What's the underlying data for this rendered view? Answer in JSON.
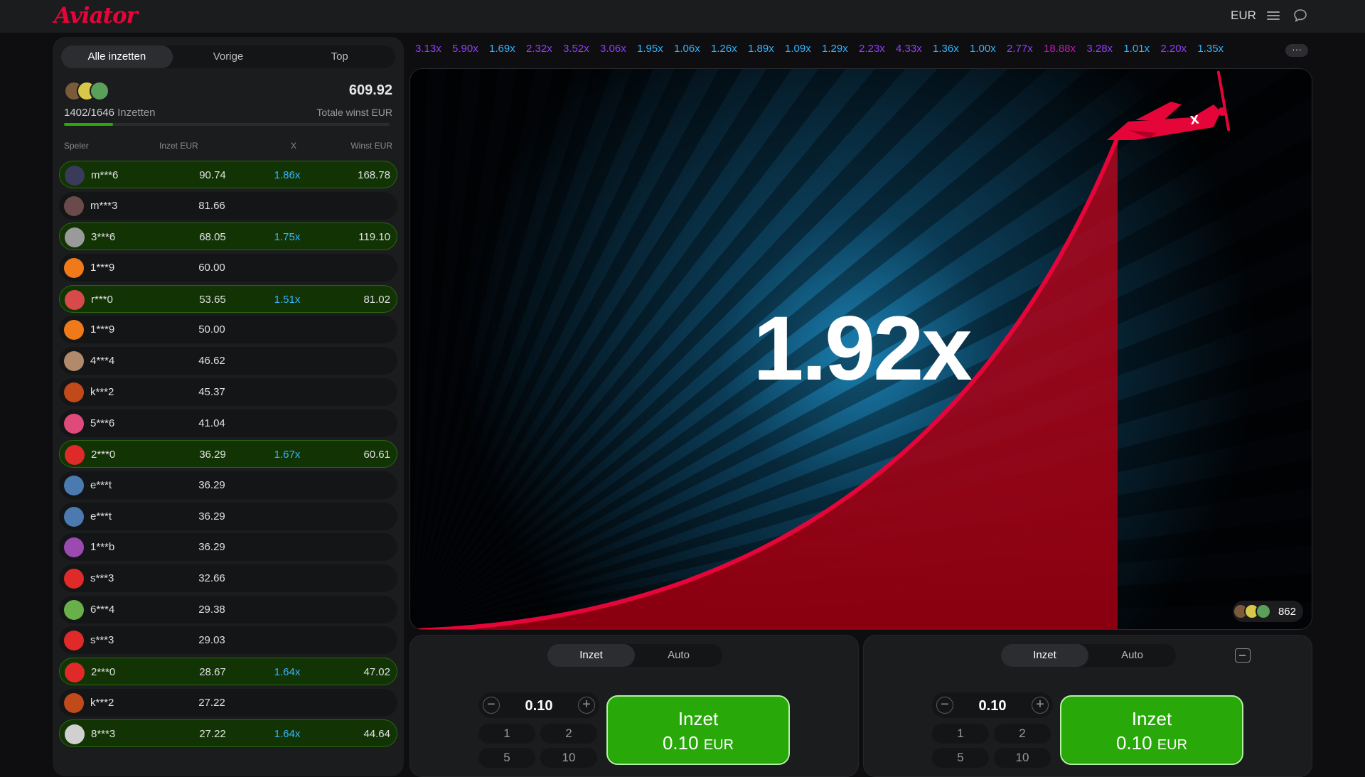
{
  "app": {
    "logo": "Aviator",
    "currency": "EUR"
  },
  "left": {
    "tabs": [
      {
        "label": "Alle inzetten",
        "active": true
      },
      {
        "label": "Vorige",
        "active": false
      },
      {
        "label": "Top",
        "active": false
      }
    ],
    "stats": {
      "total_win": "609.92",
      "bet_count": "1402/1646",
      "bet_count_label": "Inzetten",
      "total_win_label": "Totale winst EUR",
      "progress_fraction": 0.15
    },
    "columns": {
      "player": "Speler",
      "bet": "Inzet EUR",
      "mult": "X",
      "win": "Winst EUR"
    },
    "rows": [
      {
        "name": "m***6",
        "bet": "90.74",
        "mult": "1.86x",
        "win": "168.78",
        "won": true,
        "color": "#3a3a5a"
      },
      {
        "name": "m***3",
        "bet": "81.66",
        "mult": "",
        "win": "",
        "won": false,
        "color": "#6a4a4a"
      },
      {
        "name": "3***6",
        "bet": "68.05",
        "mult": "1.75x",
        "win": "119.10",
        "won": true,
        "color": "#9a9a9a"
      },
      {
        "name": "1***9",
        "bet": "60.00",
        "mult": "",
        "win": "",
        "won": false,
        "color": "#f07a1a"
      },
      {
        "name": "r***0",
        "bet": "53.65",
        "mult": "1.51x",
        "win": "81.02",
        "won": true,
        "color": "#d84a4a"
      },
      {
        "name": "1***9",
        "bet": "50.00",
        "mult": "",
        "win": "",
        "won": false,
        "color": "#f07a1a"
      },
      {
        "name": "4***4",
        "bet": "46.62",
        "mult": "",
        "win": "",
        "won": false,
        "color": "#b08a6a"
      },
      {
        "name": "k***2",
        "bet": "45.37",
        "mult": "",
        "win": "",
        "won": false,
        "color": "#c04a1a"
      },
      {
        "name": "5***6",
        "bet": "41.04",
        "mult": "",
        "win": "",
        "won": false,
        "color": "#e04a7a"
      },
      {
        "name": "2***0",
        "bet": "36.29",
        "mult": "1.67x",
        "win": "60.61",
        "won": true,
        "color": "#e02a2a"
      },
      {
        "name": "e***t",
        "bet": "36.29",
        "mult": "",
        "win": "",
        "won": false,
        "color": "#4a7ab0"
      },
      {
        "name": "e***t",
        "bet": "36.29",
        "mult": "",
        "win": "",
        "won": false,
        "color": "#4a7ab0"
      },
      {
        "name": "1***b",
        "bet": "36.29",
        "mult": "",
        "win": "",
        "won": false,
        "color": "#9a4ab0"
      },
      {
        "name": "s***3",
        "bet": "32.66",
        "mult": "",
        "win": "",
        "won": false,
        "color": "#e02a2a"
      },
      {
        "name": "6***4",
        "bet": "29.38",
        "mult": "",
        "win": "",
        "won": false,
        "color": "#6ab04a"
      },
      {
        "name": "s***3",
        "bet": "29.03",
        "mult": "",
        "win": "",
        "won": false,
        "color": "#e02a2a"
      },
      {
        "name": "2***0",
        "bet": "28.67",
        "mult": "1.64x",
        "win": "47.02",
        "won": true,
        "color": "#e02a2a"
      },
      {
        "name": "k***2",
        "bet": "27.22",
        "mult": "",
        "win": "",
        "won": false,
        "color": "#c04a1a"
      },
      {
        "name": "8***3",
        "bet": "27.22",
        "mult": "1.64x",
        "win": "44.64",
        "won": true,
        "color": "#d0d0d0"
      }
    ]
  },
  "history": [
    {
      "value": "3.13x",
      "color": "#913ef8"
    },
    {
      "value": "5.90x",
      "color": "#913ef8"
    },
    {
      "value": "1.69x",
      "color": "#34b4ff"
    },
    {
      "value": "2.32x",
      "color": "#913ef8"
    },
    {
      "value": "3.52x",
      "color": "#913ef8"
    },
    {
      "value": "3.06x",
      "color": "#913ef8"
    },
    {
      "value": "1.95x",
      "color": "#34b4ff"
    },
    {
      "value": "1.06x",
      "color": "#34b4ff"
    },
    {
      "value": "1.26x",
      "color": "#34b4ff"
    },
    {
      "value": "1.89x",
      "color": "#34b4ff"
    },
    {
      "value": "1.09x",
      "color": "#34b4ff"
    },
    {
      "value": "1.29x",
      "color": "#34b4ff"
    },
    {
      "value": "2.23x",
      "color": "#913ef8"
    },
    {
      "value": "4.33x",
      "color": "#913ef8"
    },
    {
      "value": "1.36x",
      "color": "#34b4ff"
    },
    {
      "value": "1.00x",
      "color": "#34b4ff"
    },
    {
      "value": "2.77x",
      "color": "#913ef8"
    },
    {
      "value": "18.88x",
      "color": "#c017b4"
    },
    {
      "value": "3.28x",
      "color": "#913ef8"
    },
    {
      "value": "1.01x",
      "color": "#34b4ff"
    },
    {
      "value": "2.20x",
      "color": "#913ef8"
    },
    {
      "value": "1.35x",
      "color": "#34b4ff"
    }
  ],
  "history_more": "···",
  "game": {
    "multiplier": "1.92x",
    "online_count": "862"
  },
  "bet_panels": [
    {
      "tabs": [
        "Inzet",
        "Auto"
      ],
      "amount": "0.10",
      "quick": [
        "1",
        "2",
        "5",
        "10"
      ],
      "button_label": "Inzet",
      "button_amount": "0.10",
      "button_currency": "EUR"
    },
    {
      "tabs": [
        "Inzet",
        "Auto"
      ],
      "amount": "0.10",
      "quick": [
        "1",
        "2",
        "5",
        "10"
      ],
      "button_label": "Inzet",
      "button_amount": "0.10",
      "button_currency": "EUR"
    }
  ],
  "colors": {
    "accent_red": "#e50539",
    "win_green": "#28a909",
    "mult_blue": "#34b4ff",
    "mult_purple": "#913ef8"
  }
}
